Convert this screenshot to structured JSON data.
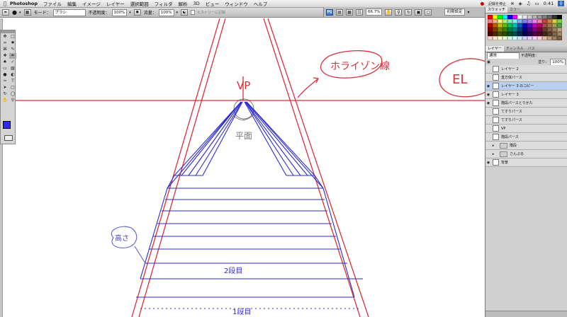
{
  "menubar": {
    "apple": "",
    "app": "Photoshop",
    "items": [
      "ファイル",
      "編集",
      "イメージ",
      "レイヤー",
      "選択範囲",
      "フィルタ",
      "解析",
      "3D",
      "ビュー",
      "ウィンドウ",
      "ヘルプ"
    ],
    "status_text": "記録を停止",
    "clock": "0:41"
  },
  "options": {
    "mode_label": "モード：",
    "mode_value": "ブラシ",
    "opacity_label": "不透明度：",
    "opacity_value": "100%",
    "flow_label": "流量：",
    "flow_value": "100%",
    "history_checkbox": "ヒストリーに記録"
  },
  "appbar": {
    "zoom": "66.7%",
    "workspace": "初期設定"
  },
  "panels": {
    "swatch_tabs": [
      "スウォッチ",
      "カラー"
    ],
    "layer_tabs": [
      "レイヤー",
      "チャンネル",
      "パス"
    ],
    "blend_mode": "通常",
    "opacity_label": "不透明度：",
    "fill_label": "塗り：",
    "fill_value": "100%",
    "layers": [
      {
        "name": "レイヤー 2",
        "visible": false,
        "selected": false,
        "type": "layer"
      },
      {
        "name": "直方体パース",
        "visible": false,
        "selected": false,
        "type": "layer"
      },
      {
        "name": "レイヤー 3 のコピー",
        "visible": true,
        "selected": true,
        "type": "layer"
      },
      {
        "name": "レイヤー 3",
        "visible": true,
        "selected": false,
        "type": "layer"
      },
      {
        "name": "階段パースとりかた",
        "visible": true,
        "selected": false,
        "type": "layer"
      },
      {
        "name": "てすりパース",
        "visible": false,
        "selected": false,
        "type": "layer"
      },
      {
        "name": "てすりパース",
        "visible": false,
        "selected": false,
        "type": "layer"
      },
      {
        "name": "VP",
        "visible": false,
        "selected": false,
        "type": "layer"
      },
      {
        "name": "階段パース",
        "visible": false,
        "selected": false,
        "type": "layer"
      },
      {
        "name": "階段",
        "visible": false,
        "selected": false,
        "type": "folder"
      },
      {
        "name": "さんぷる",
        "visible": false,
        "selected": false,
        "type": "folder"
      },
      {
        "name": "背景",
        "visible": true,
        "selected": false,
        "type": "layer"
      }
    ]
  },
  "drawing": {
    "vp_label": "VP",
    "horizon_note": "ホライゾン線",
    "eye_level": "EL",
    "height_note": "高さ",
    "flat_note": "平面",
    "step2": "2段目",
    "step1": "1段目"
  },
  "colors": {
    "red": "#d8303a",
    "blue": "#2b2bd0",
    "foreground": "#2b2bff",
    "selected_layer": "#b9d1ee"
  },
  "swatch_colors": [
    "#ff0000",
    "#ffff00",
    "#00ff00",
    "#00ffff",
    "#0000ff",
    "#ff00ff",
    "#ffffff",
    "#e6e6e6",
    "#cccccc",
    "#b3b3b3",
    "#999999",
    "#808080",
    "#666666",
    "#333333",
    "#000000",
    "#f08080",
    "#f5b080",
    "#fff080",
    "#b0f080",
    "#80f0b0",
    "#80f0f0",
    "#80b0f0",
    "#8080f0",
    "#b080f0",
    "#f080f0",
    "#f080b0",
    "#d04040",
    "#d08040",
    "#d0d040",
    "#80d040",
    "#c00000",
    "#c06000",
    "#c0c000",
    "#60c000",
    "#00c060",
    "#00c0c0",
    "#0060c0",
    "#0000c0",
    "#6000c0",
    "#c000c0",
    "#c00060",
    "#a05050",
    "#a07850",
    "#a0a050",
    "#50a050",
    "#800000",
    "#804000",
    "#808000",
    "#408000",
    "#008040",
    "#008080",
    "#004080",
    "#000080",
    "#400080",
    "#800080",
    "#800040",
    "#604030",
    "#806040",
    "#a08060",
    "#c0a080",
    "#500000",
    "#502800",
    "#505000",
    "#285000",
    "#005028",
    "#005050",
    "#002850",
    "#000050",
    "#280050",
    "#500050",
    "#500028",
    "#402818",
    "#604028",
    "#806848",
    "#a08868",
    "#ffd0d0",
    "#ffe8d0",
    "#ffffd0",
    "#e8ffd0",
    "#d0ffe8",
    "#d0ffff",
    "#d0e8ff",
    "#d0d0ff",
    "#e8d0ff",
    "#ffd0ff",
    "#ffd0e8",
    "#e0c0a0",
    "#c0a080",
    "#a08060",
    "#806040"
  ]
}
